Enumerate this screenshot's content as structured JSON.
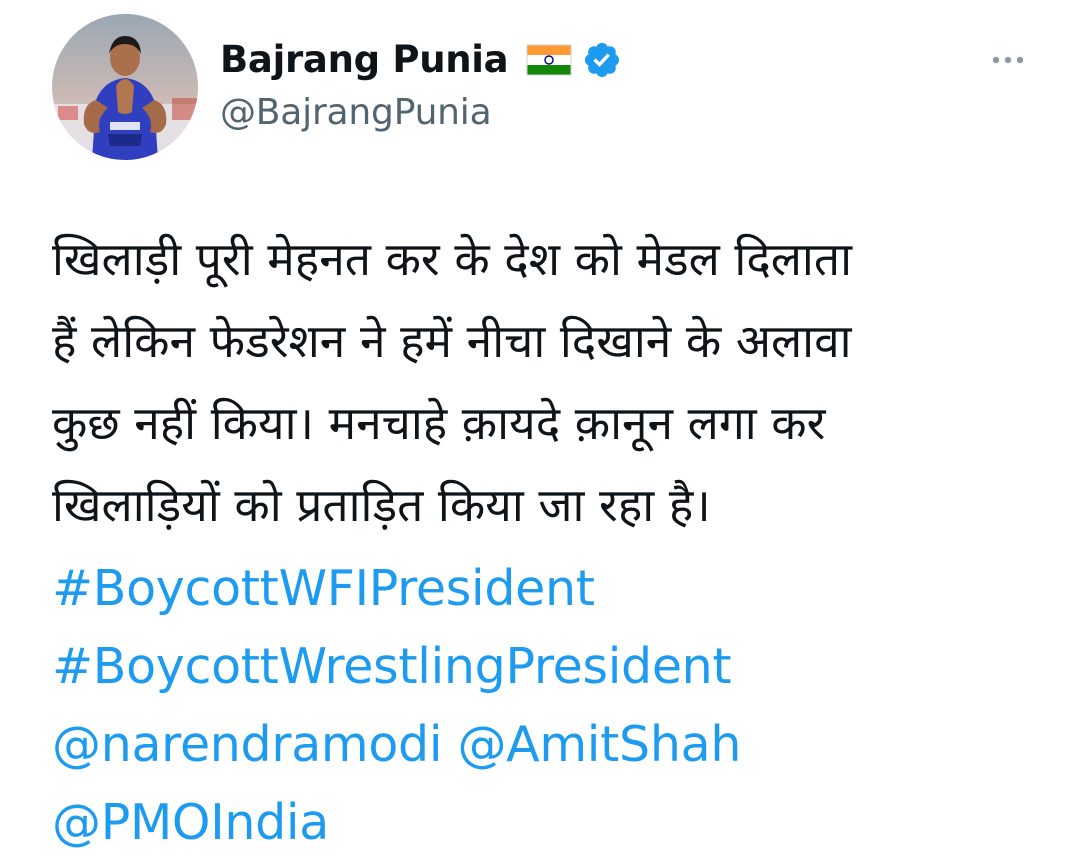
{
  "author": {
    "display_name": "Bajrang Punia",
    "handle": "@BajrangPunia",
    "avatar_icon": "profile-photo",
    "flag_icon": "india-flag-icon",
    "verified_icon": "verified-badge-icon"
  },
  "more_icon": "more-options-icon",
  "tweet": {
    "lines": [
      "खिलाड़ी पूरी मेहनत कर के देश को मेडल दिलाता",
      "हैं लेकिन फेडरेशन ने हमें नीचा दिखाने के अलावा",
      "कुछ नहीं किया। मनचाहे क़ायदे क़ानून लगा कर",
      "खिलाड़ियों को प्रताड़ित किया जा रहा है।"
    ],
    "hashtag_1": "#BoycottWFIPresident",
    "hashtag_2": "#BoycottWrestlingPresident",
    "mention_1": "@narendramodi",
    "mention_2": "@AmitShah",
    "mention_3": "@PMOIndia"
  },
  "colors": {
    "link": "#1d9bf0",
    "text": "#0f1419",
    "secondary": "#536471",
    "verified": "#1d9bf0",
    "flag_saffron": "#ff9933",
    "flag_green": "#138808",
    "flag_chakra": "#000080"
  }
}
